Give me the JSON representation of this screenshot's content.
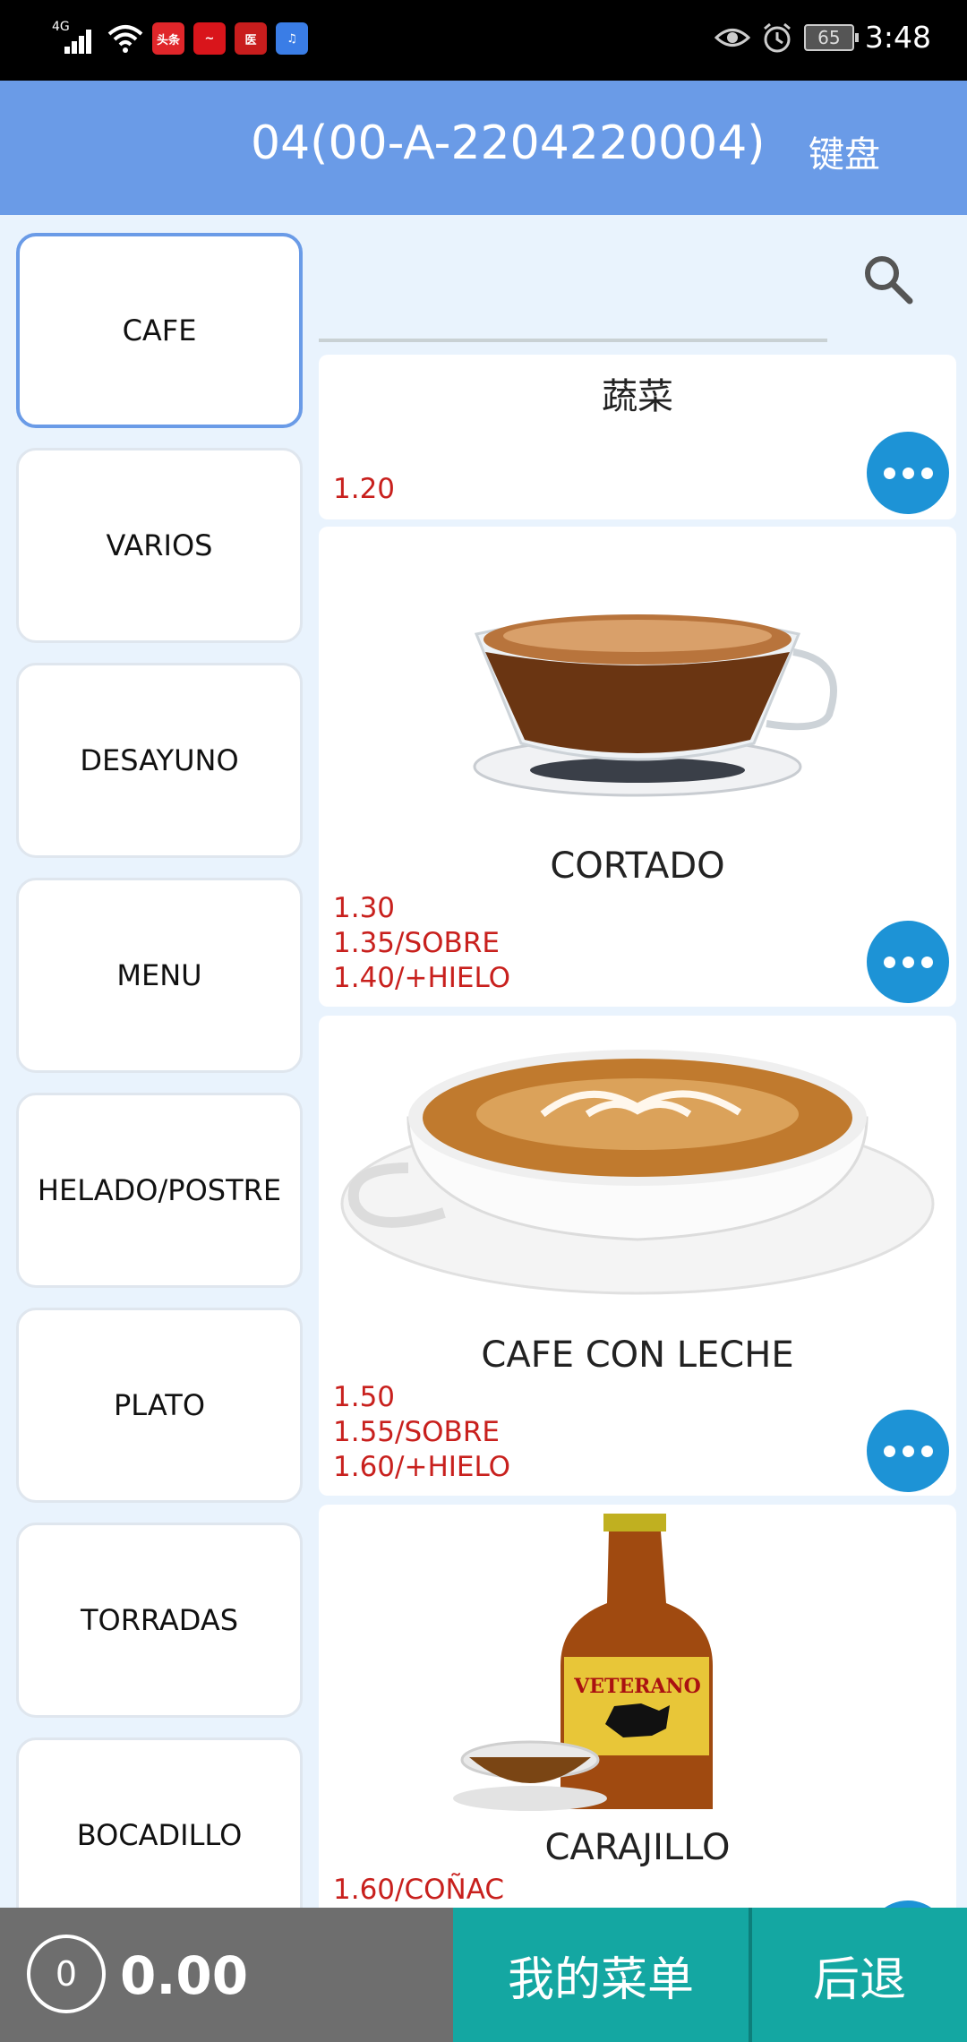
{
  "status_bar": {
    "network": "4G",
    "apps": [
      "头条",
      "~",
      "医",
      "♫"
    ],
    "battery": "65",
    "time": "3:48"
  },
  "header": {
    "title": "04(00-A-2204220004)",
    "keyboard_label": "键盘"
  },
  "categories": [
    {
      "label": "CAFE",
      "active": true
    },
    {
      "label": "VARIOS"
    },
    {
      "label": "DESAYUNO"
    },
    {
      "label": "MENU"
    },
    {
      "label": "HELADO/POSTRE"
    },
    {
      "label": "PLATO"
    },
    {
      "label": "TORRADAS"
    },
    {
      "label": "BOCADILLO"
    }
  ],
  "search": {
    "icon": "search-icon"
  },
  "products": [
    {
      "name": "蔬菜",
      "prices": [
        "1.20"
      ]
    },
    {
      "name": "CORTADO",
      "image": "espresso-cup",
      "prices": [
        "1.30",
        "1.35/SOBRE",
        "1.40/+HIELO"
      ]
    },
    {
      "name": "CAFE CON LECHE",
      "image": "latte-cup",
      "prices": [
        "1.50",
        "1.55/SOBRE",
        "1.60/+HIELO"
      ]
    },
    {
      "name": "CARAJILLO",
      "image": "brandy-bottle",
      "bottle_label": "VETERANO",
      "prices": [
        "1.60/COÑAC"
      ]
    }
  ],
  "bottom_bar": {
    "count": "0",
    "total": "0.00",
    "menu_label": "我的菜单",
    "back_label": "后退"
  },
  "colors": {
    "header": "#6a9be7",
    "price": "#c8201d",
    "more_button": "#1d93d6",
    "action_teal": "#14a7a2",
    "bottom_gray": "#6e6e6e"
  }
}
